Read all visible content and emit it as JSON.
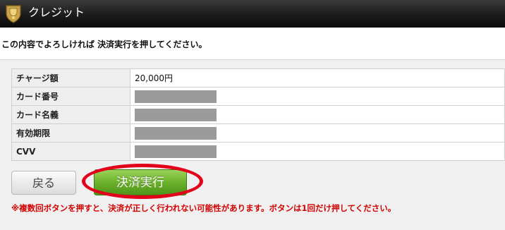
{
  "header": {
    "title": "クレジット",
    "logo_icon": "trophy-shield-icon"
  },
  "instruction": "この内容でよろしければ 決済実行を押してください。",
  "form": {
    "rows": [
      {
        "label": "チャージ額",
        "value": "20,000円"
      },
      {
        "label": "カード番号",
        "value": ""
      },
      {
        "label": "カード名義",
        "value": ""
      },
      {
        "label": "有効期限",
        "value": ""
      },
      {
        "label": "CVV",
        "value": ""
      }
    ]
  },
  "buttons": {
    "back_label": "戻る",
    "execute_label": "決済実行"
  },
  "warning": "※複数回ボタンを押すと、決済が正しく行われない可能性があります。ボタンは1回だけ押してください。",
  "colors": {
    "header_bg": "#1c1c1c",
    "execute_button": "#6cb22b",
    "highlight": "#e3001b",
    "warning_text": "#d40000"
  }
}
